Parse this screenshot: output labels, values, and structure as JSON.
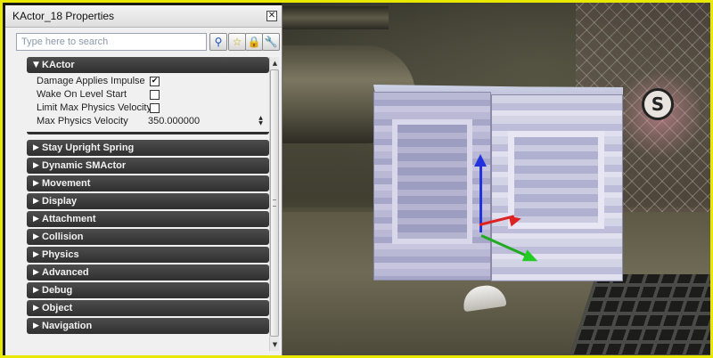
{
  "window": {
    "title": "KActor_18 Properties",
    "close_glyph": "✕"
  },
  "search": {
    "placeholder": "Type here to search",
    "value": ""
  },
  "toolbar": {
    "search_glyph": "⚲",
    "favorites_glyph": "☆",
    "lock_glyph": "🔒",
    "settings_glyph": "🔧",
    "icon_names": [
      "search-icon",
      "star-icon",
      "lock-icon",
      "wrench-icon"
    ]
  },
  "expanded_category": {
    "label": "KActor",
    "arrow": "▼",
    "properties": [
      {
        "name": "Damage Applies Impulse",
        "type": "checkbox",
        "checked": true,
        "glyph": "✔"
      },
      {
        "name": "Wake On Level Start",
        "type": "checkbox",
        "checked": false,
        "glyph": ""
      },
      {
        "name": "Limit Max Physics Velocity",
        "type": "checkbox",
        "checked": false,
        "glyph": ""
      },
      {
        "name": "Max Physics Velocity",
        "type": "number",
        "value": "350.000000"
      }
    ]
  },
  "spinner": {
    "up": "▲",
    "down": "▼"
  },
  "collapsed_categories": [
    {
      "label": "Stay Upright Spring",
      "arrow": "▶"
    },
    {
      "label": "Dynamic SMActor",
      "arrow": "▶"
    },
    {
      "label": "Movement",
      "arrow": "▶"
    },
    {
      "label": "Display",
      "arrow": "▶"
    },
    {
      "label": "Attachment",
      "arrow": "▶"
    },
    {
      "label": "Collision",
      "arrow": "▶"
    },
    {
      "label": "Physics",
      "arrow": "▶"
    },
    {
      "label": "Advanced",
      "arrow": "▶"
    },
    {
      "label": "Debug",
      "arrow": "▶"
    },
    {
      "label": "Object",
      "arrow": "▶"
    },
    {
      "label": "Navigation",
      "arrow": "▶"
    }
  ],
  "scrollbar": {
    "up": "▲",
    "down": "▼"
  },
  "viewport": {
    "sign_glyph": "S"
  },
  "colors": {
    "frame_border": "#e8e800",
    "category_header": "#3a3a3a",
    "axis_x": "#dd2222",
    "axis_y": "#22cc22",
    "axis_z": "#2233dd"
  }
}
